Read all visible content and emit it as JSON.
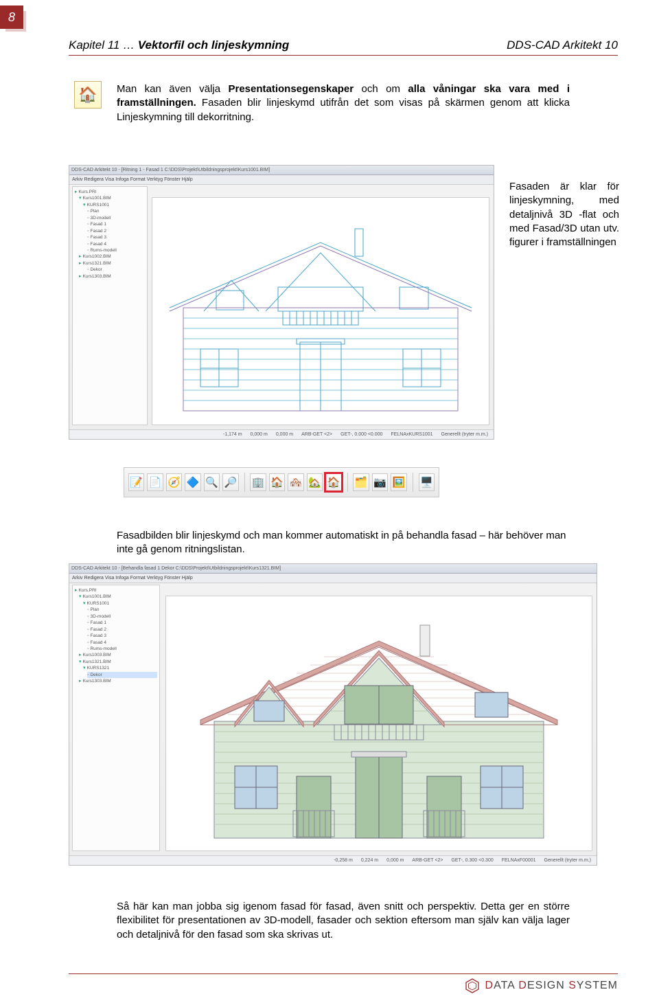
{
  "page": {
    "number": "8",
    "header_left_prefix": "Kapitel 11 … ",
    "header_left_title": "Vektorfil och linjeskymning",
    "header_right": "DDS-CAD Arkitekt 10"
  },
  "icon": {
    "emoji": "🏠"
  },
  "para1_1": "Man kan även välja ",
  "para1_b1": "Presentationsegenskaper",
  "para1_2": " och om ",
  "para1_b2": "alla våningar ska vara med i framställningen.",
  "para1_3": " Fasaden blir linjeskymd utifrån det som visas på skärmen genom att klicka Linjeskymning till dekorritning.",
  "screen1": {
    "title": "DDS-CAD Arkitekt 10 - [Ritning 1 - Fasad 1  C:\\DDS\\Projekt\\Utbildningsprojekt\\Kurs1001.BIM]",
    "menu": "Arkiv  Redigera  Visa  Infoga  Format  Verktyg  Fönster  Hjälp",
    "tree": {
      "root": "Kurs.PRI",
      "items": [
        "Kurs1001.BIM",
        "KURS1001",
        "Plan",
        "3D-modell",
        "Fasad 1",
        "Fasad 2",
        "Fasad 3",
        "Fasad 4",
        "Rums-modell",
        "Kurs1002.BIM",
        "Kurs1321.BIM",
        "Dekor",
        "Kurs1303.BIM"
      ]
    },
    "status": [
      "-1,174 m",
      "0,000 m",
      "0,000 m",
      "ARB-GET <2>",
      "GET-, 0.000 <0.000",
      "FELNAxKURS1001",
      "Generellt (tryter m.m.)"
    ]
  },
  "sidenote": "Fasaden är klar för linjeskymning, med detaljnivå 3D -flat och med Fasad/3D utan utv. figurer i framställningen",
  "toolbar": {
    "icons": [
      "📝",
      "📄",
      "🧭",
      "🔷",
      "🔍",
      "🔎"
    ],
    "icons2": [
      "🏢",
      "🏠",
      "🏘️",
      "🏡"
    ],
    "highlight": "🏠",
    "icons3": [
      "🗂️",
      "📷",
      "🖼️"
    ],
    "icons4": [
      "🖥️"
    ]
  },
  "para2": "Fasadbilden blir linjeskymd och man kommer automatiskt in på behandla fasad – här behöver man inte gå genom ritningslistan.",
  "screen2": {
    "title": "DDS-CAD Arkitekt 10 - [Behandla fasad 1  Dekor  C:\\DDS\\Projekt\\Utbildningsprojekt\\Kurs1321.BIM]",
    "menu": "Arkiv  Redigera  Visa  Infoga  Format  Verktyg  Fönster  Hjälp",
    "tree": {
      "root": "Kurs.PRI",
      "items": [
        "Kurs1001.BIM",
        "KURS1001",
        "Plan",
        "3D-modell",
        "Fasad 1",
        "Fasad 2",
        "Fasad 3",
        "Fasad 4",
        "Rums-modell",
        "Kurs1003.BIM",
        "Kurs1321.BIM",
        "KURS1321",
        "Dekor",
        "Kurs1303.BIM"
      ]
    },
    "status": [
      "-0,258 m",
      "0,224 m",
      "0,000 m",
      "ARB-GET <2>",
      "GET-, 0.300 <0.300",
      "FELNAxF00001",
      "Generellt (tryter m.m.)"
    ]
  },
  "para3": "Så här kan man jobba sig igenom fasad för fasad, även snitt och perspektiv. Detta ger en större flexibilitet för presentationen av 3D-modell, fasader och sektion eftersom man själv kan välja lager och detaljnivå för den fasad som ska skrivas ut.",
  "footer": {
    "brand1": "D",
    "brand2": "ATA ",
    "brand3": "D",
    "brand4": "ESIGN ",
    "brand5": "S",
    "brand6": "YSTEM"
  }
}
